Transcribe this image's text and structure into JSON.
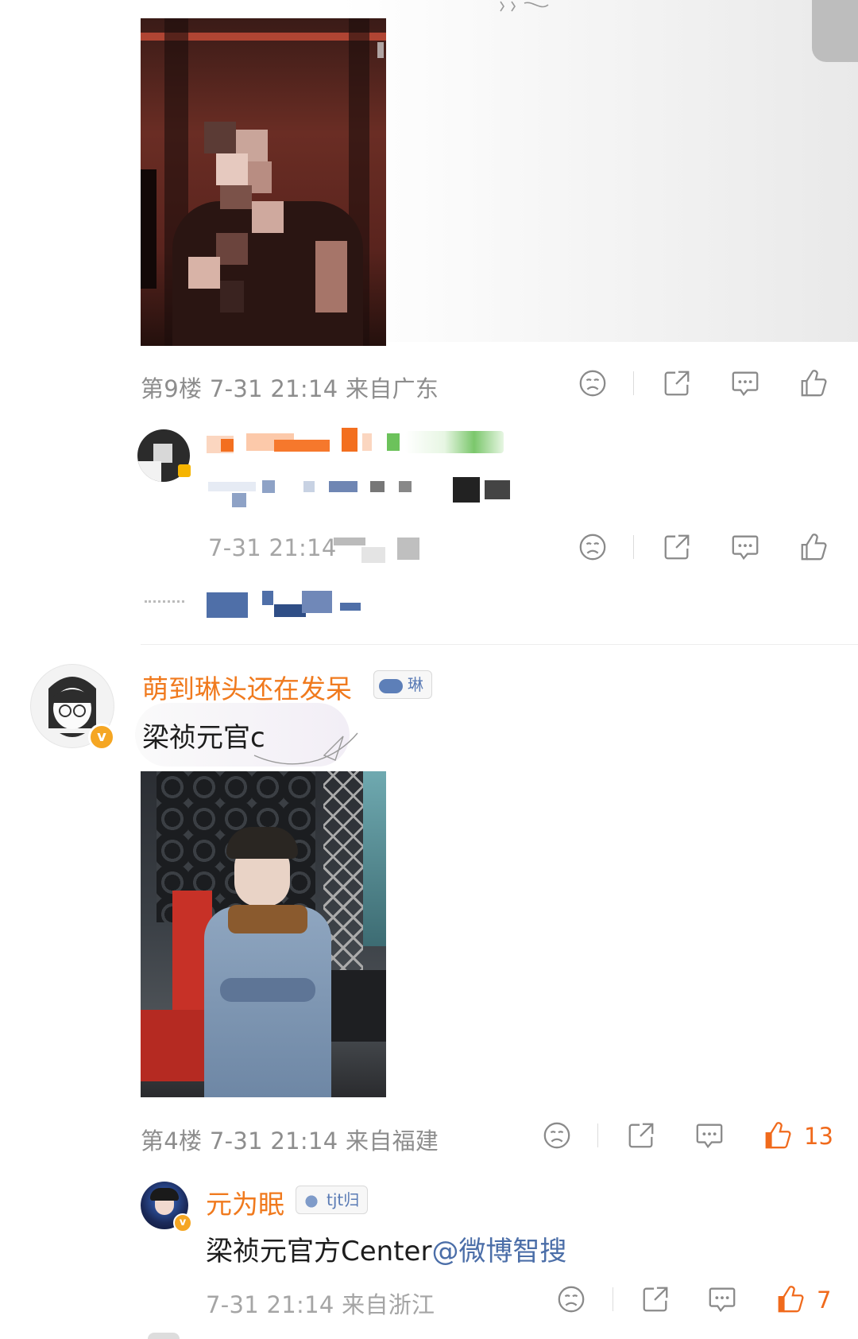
{
  "comment_9": {
    "floor": "第9楼",
    "time": "7-31 21:14",
    "location": "来自广东"
  },
  "reply_9": {
    "time": "7-31 21:14"
  },
  "comment_4": {
    "username": "萌到琳头还在发呆",
    "fan_badge": "琳",
    "text": "梁祯元官c",
    "floor": "第4楼",
    "time": "7-31 21:14",
    "location": "来自福建",
    "likes": "13"
  },
  "reply_4": {
    "username": "元为眠",
    "fan_badge": "tjt归",
    "text_prefix": "梁祯元官方Center",
    "mention": "@微博智搜",
    "time": "7-31 21:14",
    "location": "来自浙江",
    "likes": "7"
  },
  "icons": [
    "dislike-icon",
    "share-icon",
    "comment-icon",
    "like-icon"
  ],
  "colors": {
    "username": "#f07a1e",
    "mention": "#4b6ea8",
    "like_active": "#f06a1c",
    "meta_gray": "#8d8d8d",
    "verified_badge": "#f5a623"
  }
}
